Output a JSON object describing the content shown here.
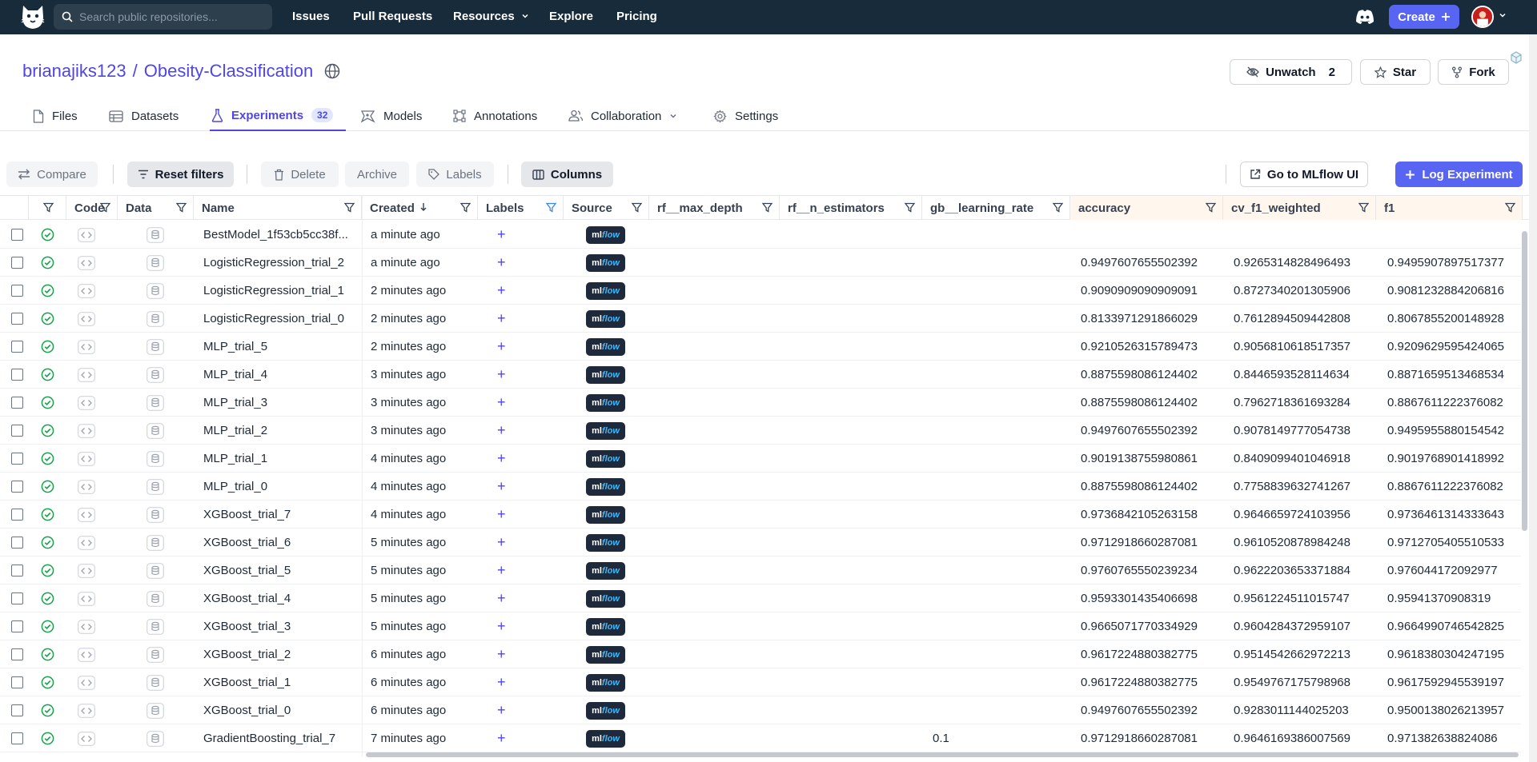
{
  "search": {
    "placeholder": "Search public repositories..."
  },
  "nav": {
    "items": [
      "Issues",
      "Pull Requests",
      "Resources",
      "Explore",
      "Pricing"
    ],
    "create_label": "Create"
  },
  "repo": {
    "owner": "brianajiks123",
    "sep": "/",
    "name": "Obesity-Classification",
    "unwatch_label": "Unwatch",
    "watch_count": "2",
    "star_label": "Star",
    "fork_label": "Fork"
  },
  "tabs": [
    {
      "label": "Files"
    },
    {
      "label": "Datasets"
    },
    {
      "label": "Experiments",
      "count": "32"
    },
    {
      "label": "Models"
    },
    {
      "label": "Annotations"
    },
    {
      "label": "Collaboration"
    },
    {
      "label": "Settings"
    }
  ],
  "toolbar": {
    "compare": "Compare",
    "reset_filters": "Reset filters",
    "delete": "Delete",
    "archive": "Archive",
    "labels": "Labels",
    "columns": "Columns",
    "mlflow_ui": "Go to MLflow UI",
    "log_experiment": "Log Experiment"
  },
  "table": {
    "columns": [
      "Code",
      "Data",
      "Name",
      "Created",
      "Labels",
      "Source",
      "rf__max_depth",
      "rf__n_estimators",
      "gb__learning_rate",
      "accuracy",
      "cv_f1_weighted",
      "f1"
    ],
    "source_badge": {
      "ml": "ml",
      "flow": "flow"
    },
    "label_add": "+",
    "rows": [
      {
        "name": "BestModel_1f53cb5cc38f...",
        "created": "a minute ago",
        "gb_lr": "",
        "accuracy": "",
        "cv_f1": "",
        "f1": ""
      },
      {
        "name": "LogisticRegression_trial_2",
        "created": "a minute ago",
        "gb_lr": "",
        "accuracy": "0.9497607655502392",
        "cv_f1": "0.9265314828496493",
        "f1": "0.9495907897517377"
      },
      {
        "name": "LogisticRegression_trial_1",
        "created": "2 minutes ago",
        "gb_lr": "",
        "accuracy": "0.9090909090909091",
        "cv_f1": "0.8727340201305906",
        "f1": "0.9081232884206816"
      },
      {
        "name": "LogisticRegression_trial_0",
        "created": "2 minutes ago",
        "gb_lr": "",
        "accuracy": "0.8133971291866029",
        "cv_f1": "0.7612894509442808",
        "f1": "0.8067855200148928"
      },
      {
        "name": "MLP_trial_5",
        "created": "2 minutes ago",
        "gb_lr": "",
        "accuracy": "0.9210526315789473",
        "cv_f1": "0.9056810618517357",
        "f1": "0.9209629595424065"
      },
      {
        "name": "MLP_trial_4",
        "created": "3 minutes ago",
        "gb_lr": "",
        "accuracy": "0.8875598086124402",
        "cv_f1": "0.8446593528114634",
        "f1": "0.8871659513468534"
      },
      {
        "name": "MLP_trial_3",
        "created": "3 minutes ago",
        "gb_lr": "",
        "accuracy": "0.8875598086124402",
        "cv_f1": "0.7962718361693284",
        "f1": "0.8867611222376082"
      },
      {
        "name": "MLP_trial_2",
        "created": "3 minutes ago",
        "gb_lr": "",
        "accuracy": "0.9497607655502392",
        "cv_f1": "0.9078149777054738",
        "f1": "0.9495955880154542"
      },
      {
        "name": "MLP_trial_1",
        "created": "4 minutes ago",
        "gb_lr": "",
        "accuracy": "0.9019138755980861",
        "cv_f1": "0.8409099401046918",
        "f1": "0.9019768901418992"
      },
      {
        "name": "MLP_trial_0",
        "created": "4 minutes ago",
        "gb_lr": "",
        "accuracy": "0.8875598086124402",
        "cv_f1": "0.7758839632741267",
        "f1": "0.8867611222376082"
      },
      {
        "name": "XGBoost_trial_7",
        "created": "4 minutes ago",
        "gb_lr": "",
        "accuracy": "0.9736842105263158",
        "cv_f1": "0.9646659724103956",
        "f1": "0.9736461314333643"
      },
      {
        "name": "XGBoost_trial_6",
        "created": "5 minutes ago",
        "gb_lr": "",
        "accuracy": "0.9712918660287081",
        "cv_f1": "0.9610520878984248",
        "f1": "0.9712705405510533"
      },
      {
        "name": "XGBoost_trial_5",
        "created": "5 minutes ago",
        "gb_lr": "",
        "accuracy": "0.9760765550239234",
        "cv_f1": "0.9622203653371884",
        "f1": "0.976044172092977"
      },
      {
        "name": "XGBoost_trial_4",
        "created": "5 minutes ago",
        "gb_lr": "",
        "accuracy": "0.9593301435406698",
        "cv_f1": "0.9561224511015747",
        "f1": "0.95941370908319"
      },
      {
        "name": "XGBoost_trial_3",
        "created": "5 minutes ago",
        "gb_lr": "",
        "accuracy": "0.9665071770334929",
        "cv_f1": "0.9604284372959107",
        "f1": "0.9664990746542825"
      },
      {
        "name": "XGBoost_trial_2",
        "created": "6 minutes ago",
        "gb_lr": "",
        "accuracy": "0.9617224880382775",
        "cv_f1": "0.9514542662972213",
        "f1": "0.9618380304247195"
      },
      {
        "name": "XGBoost_trial_1",
        "created": "6 minutes ago",
        "gb_lr": "",
        "accuracy": "0.9617224880382775",
        "cv_f1": "0.9549767175798968",
        "f1": "0.9617592945539197"
      },
      {
        "name": "XGBoost_trial_0",
        "created": "6 minutes ago",
        "gb_lr": "",
        "accuracy": "0.9497607655502392",
        "cv_f1": "0.9283011144025203",
        "f1": "0.9500138026213957"
      },
      {
        "name": "GradientBoosting_trial_7",
        "created": "7 minutes ago",
        "gb_lr": "0.1",
        "accuracy": "0.9712918660287081",
        "cv_f1": "0.9646169386007569",
        "f1": "0.971382638824086"
      }
    ]
  },
  "colors": {
    "accent": "#5865f2",
    "nav_bg": "#172b3a",
    "success": "#16a34a",
    "link": "#4f46e5"
  }
}
